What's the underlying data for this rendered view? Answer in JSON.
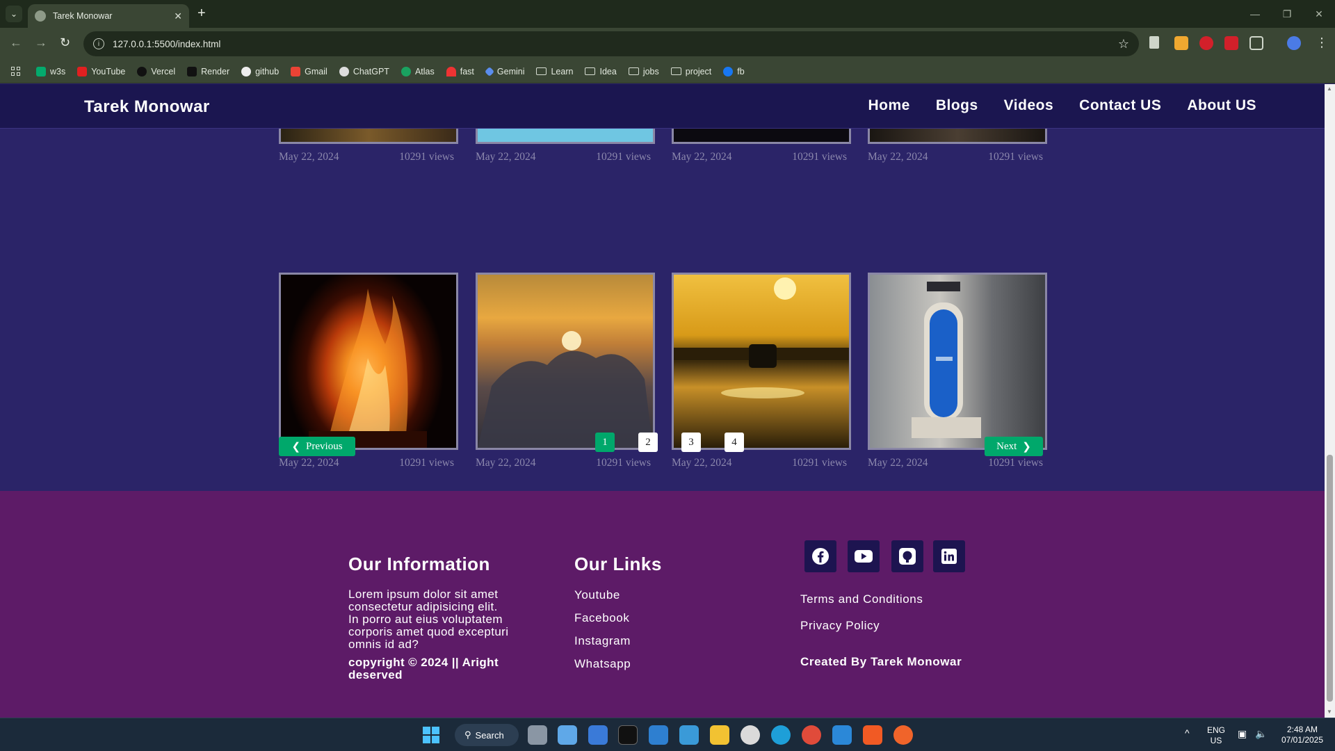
{
  "browser": {
    "tab_title": "Tarek Monowar",
    "url": "127.0.0.1:5500/index.html",
    "bookmarks": [
      "w3s",
      "YouTube",
      "Vercel",
      "Render",
      "github",
      "Gmail",
      "ChatGPT",
      "Atlas",
      "fast",
      "Gemini",
      "Learn",
      "Idea",
      "jobs",
      "project",
      "fb"
    ]
  },
  "header": {
    "brand": "Tarek Monowar",
    "nav": [
      "Home",
      "Blogs",
      "Videos",
      "Contact US",
      "About US"
    ]
  },
  "gallery": {
    "top_row": [
      {
        "date": "May 22, 2024",
        "views": "10291 views"
      },
      {
        "date": "May 22, 2024",
        "views": "10291 views"
      },
      {
        "date": "May 22, 2024",
        "views": "10291 views"
      },
      {
        "date": "May 22, 2024",
        "views": "10291 views"
      }
    ],
    "cards": [
      {
        "image": "campfire",
        "date": "May 22, 2024",
        "views": "10291 views"
      },
      {
        "image": "sunset-clouds",
        "date": "May 22, 2024",
        "views": "10291 views"
      },
      {
        "image": "jeep-sunset",
        "date": "May 22, 2024",
        "views": "10291 views"
      },
      {
        "image": "blue-door",
        "date": "May 22, 2024",
        "views": "10291 views"
      }
    ]
  },
  "pagination": {
    "previous": "Previous",
    "next": "Next",
    "pages": [
      "1",
      "2",
      "3",
      "4"
    ],
    "active_page": "1"
  },
  "footer": {
    "info_title": "Our Information",
    "info_lines": [
      "Lorem ipsum dolor sit amet",
      "consectetur adipisicing elit.",
      "In porro aut eius voluptatem",
      "corporis amet quod excepturi",
      "omnis id ad?"
    ],
    "copyright_lines": [
      "copyright © 2024 || Aright",
      "deserved"
    ],
    "links_title": "Our Links",
    "links": [
      "Youtube",
      "Facebook",
      "Instagram",
      "Whatsapp"
    ],
    "social_icons": [
      "facebook-icon",
      "youtube-icon",
      "github-icon",
      "linkedin-icon"
    ],
    "policy_links": [
      "Terms and Conditions",
      "Privacy Policy"
    ],
    "created_by": "Created By Tarek Monowar"
  },
  "taskbar": {
    "search": "Search",
    "lang": "ENG",
    "region": "US",
    "time": "2:48 AM",
    "date": "07/01/2025"
  },
  "colors": {
    "header_bg": "#1b1650",
    "content_bg": "#2b2468",
    "footer_bg": "#5d1b67",
    "accent_green": "#00a86b"
  }
}
